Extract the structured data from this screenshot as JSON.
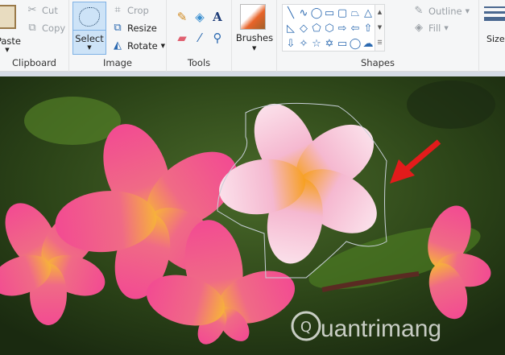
{
  "ribbon": {
    "clipboard": {
      "paste": "Paste",
      "cut": "Cut",
      "copy": "Copy",
      "label": "Clipboard"
    },
    "image": {
      "select": "Select",
      "crop": "Crop",
      "resize": "Resize",
      "rotate": "Rotate",
      "label": "Image"
    },
    "tools": {
      "label": "Tools",
      "items": [
        "pencil-icon",
        "fill-icon",
        "text-icon",
        "eraser-icon",
        "color-picker-icon",
        "magnifier-icon"
      ]
    },
    "brushes": {
      "label": "Brushes"
    },
    "shapes": {
      "label": "Shapes",
      "outline": "Outline",
      "fill": "Fill",
      "glyphs": [
        "╲",
        "∿",
        "◯",
        "▭",
        "▢",
        "⏢",
        "△",
        "◺",
        "◇",
        "⬠",
        "⬡",
        "⇨",
        "⇦",
        "⇧",
        "⇩",
        "✧",
        "☆",
        "✡",
        "▭",
        "◯",
        "☁"
      ]
    },
    "size": {
      "label": "Size"
    }
  },
  "watermark": {
    "text": "uantrimang",
    "letter": "Q"
  },
  "colors": {
    "accent": "#2b69b0",
    "arrow": "#e31b1b",
    "petal": "#f0559a"
  }
}
